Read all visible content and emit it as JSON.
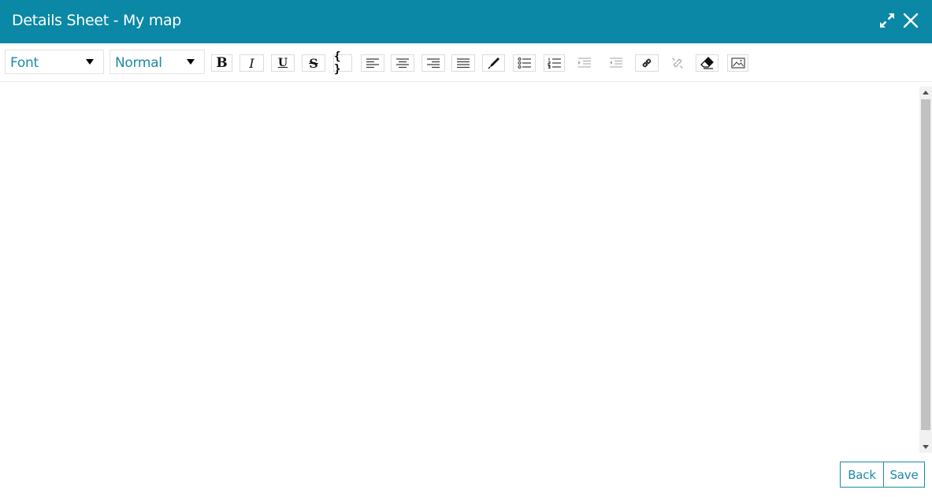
{
  "window": {
    "title": "Details Sheet - My map",
    "header_color": "#0a88a5"
  },
  "toolbar": {
    "font_select": "Font",
    "size_select": "Normal",
    "buttons": [
      {
        "icon": "bold-icon",
        "glyph": "B"
      },
      {
        "icon": "italic-icon",
        "glyph": "I"
      },
      {
        "icon": "underline-icon",
        "glyph": "U"
      },
      {
        "icon": "strikethrough-icon",
        "glyph": "S"
      },
      {
        "icon": "code-block-icon",
        "glyph": "{ }"
      },
      {
        "icon": "align-left-icon"
      },
      {
        "icon": "align-center-icon"
      },
      {
        "icon": "align-right-icon"
      },
      {
        "icon": "align-justify-icon"
      },
      {
        "icon": "text-color-icon"
      },
      {
        "icon": "bullet-list-icon"
      },
      {
        "icon": "numbered-list-icon"
      },
      {
        "icon": "indent-icon"
      },
      {
        "icon": "outdent-icon"
      },
      {
        "icon": "link-icon"
      },
      {
        "icon": "unlink-icon"
      },
      {
        "icon": "clear-format-icon"
      },
      {
        "icon": "image-icon"
      }
    ]
  },
  "editor": {
    "content": ""
  },
  "footer": {
    "back_label": "Back",
    "save_label": "Save"
  },
  "colors": {
    "accent": "#1b8aa5",
    "border": "#dcdcdc"
  }
}
